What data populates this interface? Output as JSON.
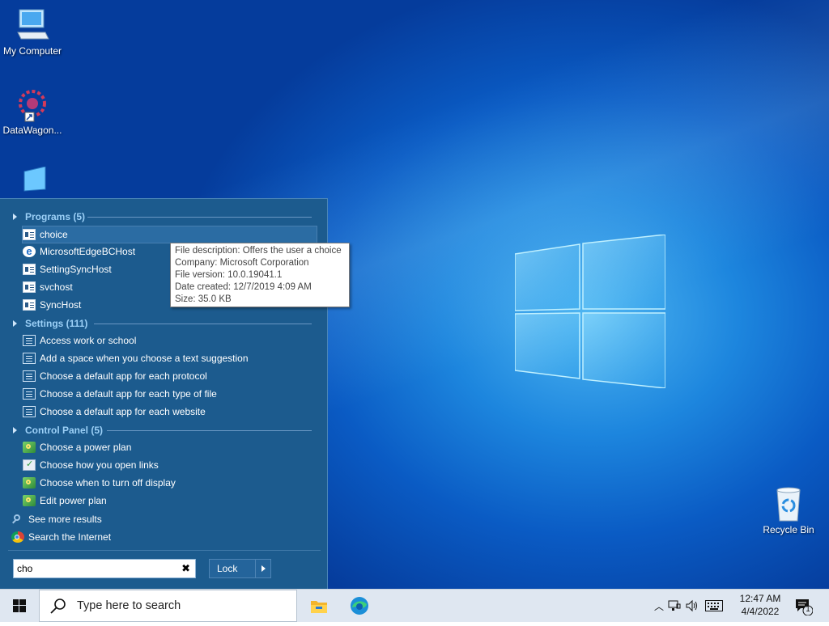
{
  "desktop": {
    "icons": [
      {
        "label": "My Computer"
      },
      {
        "label": "DataWagon..."
      },
      {
        "label": "Recycle Bin"
      }
    ]
  },
  "start_menu": {
    "groups": {
      "programs": {
        "header": "Programs (5)"
      },
      "settings": {
        "header": "Settings (111)"
      },
      "control_panel": {
        "header": "Control Panel (5)"
      }
    },
    "programs": [
      {
        "label": "choice",
        "icon": "exe-icon"
      },
      {
        "label": "MicrosoftEdgeBCHost",
        "icon": "edge-icon"
      },
      {
        "label": "SettingSyncHost",
        "icon": "exe-icon"
      },
      {
        "label": "svchost",
        "icon": "exe-icon"
      },
      {
        "label": "SyncHost",
        "icon": "exe-icon"
      }
    ],
    "settings": [
      {
        "label": "Access work or school"
      },
      {
        "label": "Add a space when you choose a text suggestion"
      },
      {
        "label": "Choose a default app for each protocol"
      },
      {
        "label": "Choose a default app for each type of file"
      },
      {
        "label": "Choose a default app for each website"
      }
    ],
    "control_panel": [
      {
        "label": "Choose a power plan"
      },
      {
        "label": "Choose how you open links"
      },
      {
        "label": "Choose when to turn off display"
      },
      {
        "label": "Edit power plan"
      }
    ],
    "see_more": "See more results",
    "search_internet": "Search the Internet",
    "search_value": "cho",
    "clear_glyph": "✖",
    "lock_label": "Lock"
  },
  "tooltip": {
    "lines": [
      "File description: Offers the user a choice",
      "Company: Microsoft Corporation",
      "File version: 10.0.19041.1",
      "Date created: 12/7/2019 4:09 AM",
      "Size: 35.0 KB"
    ]
  },
  "taskbar": {
    "search_placeholder": "Type here to search",
    "time": "12:47 AM",
    "date": "4/4/2022",
    "notification_count": "1"
  },
  "colors": {
    "menu_bg": "#1c5b8e",
    "group_header": "#9cd0f7",
    "taskbar_bg": "#dfe7f1"
  }
}
